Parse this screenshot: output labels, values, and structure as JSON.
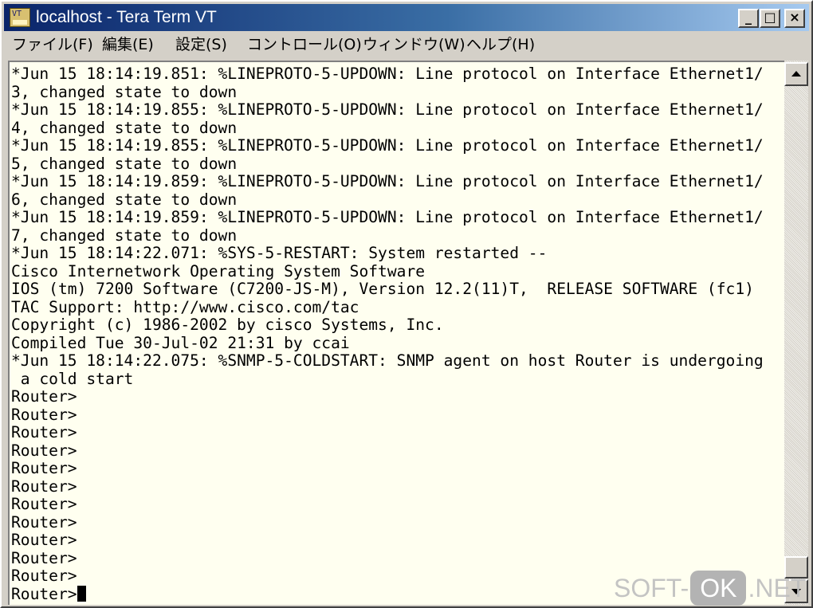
{
  "window": {
    "title": "localhost - Tera Term VT",
    "controls": {
      "minimize": "_",
      "maximize": "□",
      "close": "×"
    }
  },
  "menu": {
    "items": [
      "ファイル(F)",
      "編集(E)",
      "設定(S)",
      "コントロール(O)",
      "ウィンドウ(W)",
      "ヘルプ(H)"
    ]
  },
  "terminal": {
    "lines": [
      "*Jun 15 18:14:19.851: %LINEPROTO-5-UPDOWN: Line protocol on Interface Ethernet1/",
      "3, changed state to down",
      "*Jun 15 18:14:19.855: %LINEPROTO-5-UPDOWN: Line protocol on Interface Ethernet1/",
      "4, changed state to down",
      "*Jun 15 18:14:19.855: %LINEPROTO-5-UPDOWN: Line protocol on Interface Ethernet1/",
      "5, changed state to down",
      "*Jun 15 18:14:19.859: %LINEPROTO-5-UPDOWN: Line protocol on Interface Ethernet1/",
      "6, changed state to down",
      "*Jun 15 18:14:19.859: %LINEPROTO-5-UPDOWN: Line protocol on Interface Ethernet1/",
      "7, changed state to down",
      "*Jun 15 18:14:22.071: %SYS-5-RESTART: System restarted --",
      "Cisco Internetwork Operating System Software",
      "IOS (tm) 7200 Software (C7200-JS-M), Version 12.2(11)T,  RELEASE SOFTWARE (fc1)",
      "TAC Support: http://www.cisco.com/tac",
      "Copyright (c) 1986-2002 by cisco Systems, Inc.",
      "Compiled Tue 30-Jul-02 21:31 by ccai",
      "*Jun 15 18:14:22.075: %SNMP-5-COLDSTART: SNMP agent on host Router is undergoing",
      " a cold start",
      "Router>",
      "Router>",
      "Router>",
      "Router>",
      "Router>",
      "Router>",
      "Router>",
      "Router>",
      "Router>",
      "Router>",
      "Router>"
    ],
    "prompt": "Router>"
  },
  "scrollbar": {
    "up_icon": "arrow-up-icon",
    "down_icon": "arrow-down-icon"
  },
  "watermark": {
    "left": "SOFT-",
    "badge": "OK",
    "right": ".NET"
  }
}
